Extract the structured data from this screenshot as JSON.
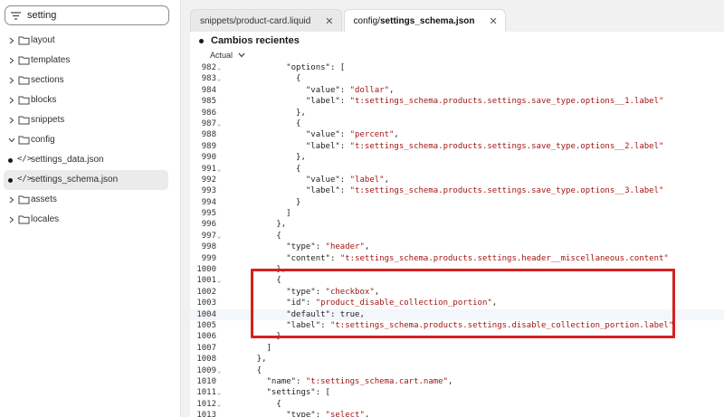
{
  "search": {
    "value": "setting",
    "placeholder": ""
  },
  "tree": [
    {
      "label": "layout",
      "type": "folder"
    },
    {
      "label": "templates",
      "type": "folder"
    },
    {
      "label": "sections",
      "type": "folder"
    },
    {
      "label": "blocks",
      "type": "folder"
    },
    {
      "label": "snippets",
      "type": "folder"
    },
    {
      "label": "config",
      "type": "folder-open"
    },
    {
      "label": "settings_data.json",
      "type": "file"
    },
    {
      "label": "settings_schema.json",
      "type": "file",
      "active": true
    },
    {
      "label": "assets",
      "type": "folder"
    },
    {
      "label": "locales",
      "type": "folder"
    }
  ],
  "tabs": [
    {
      "label": "snippets/product-card.liquid",
      "close": "✕"
    },
    {
      "prefix": "config/",
      "name": "settings_schema.json",
      "close": "✕"
    }
  ],
  "changes": {
    "title": "Cambios recientes",
    "version": "Actual"
  },
  "code": [
    {
      "n": "982",
      "fold": true,
      "t": "          \"options\": ["
    },
    {
      "n": "983",
      "fold": true,
      "t": "            {"
    },
    {
      "n": "984",
      "t": "              \"value\": \"dollar\","
    },
    {
      "n": "985",
      "t": "              \"label\": \"t:settings_schema.products.settings.save_type.options__1.label\""
    },
    {
      "n": "986",
      "t": "            },"
    },
    {
      "n": "987",
      "fold": true,
      "t": "            {"
    },
    {
      "n": "988",
      "t": "              \"value\": \"percent\","
    },
    {
      "n": "989",
      "t": "              \"label\": \"t:settings_schema.products.settings.save_type.options__2.label\""
    },
    {
      "n": "990",
      "t": "            },"
    },
    {
      "n": "991",
      "fold": true,
      "t": "            {"
    },
    {
      "n": "992",
      "t": "              \"value\": \"label\","
    },
    {
      "n": "993",
      "t": "              \"label\": \"t:settings_schema.products.settings.save_type.options__3.label\""
    },
    {
      "n": "994",
      "t": "            }"
    },
    {
      "n": "995",
      "t": "          ]"
    },
    {
      "n": "996",
      "t": "        },"
    },
    {
      "n": "997",
      "fold": true,
      "t": "        {"
    },
    {
      "n": "998",
      "t": "          \"type\": \"header\","
    },
    {
      "n": "999",
      "t": "          \"content\": \"t:settings_schema.products.settings.header__miscellaneous.content\""
    },
    {
      "n": "1000",
      "t": "        },"
    },
    {
      "n": "1001",
      "fold": true,
      "t": "        {"
    },
    {
      "n": "1002",
      "t": "          \"type\": \"checkbox\","
    },
    {
      "n": "1003",
      "t": "          \"id\": \"product_disable_collection_portion\","
    },
    {
      "n": "1004",
      "t": "          \"default\": true,",
      "current": true
    },
    {
      "n": "1005",
      "t": "          \"label\": \"t:settings_schema.products.settings.disable_collection_portion.label\""
    },
    {
      "n": "1006",
      "t": "        }"
    },
    {
      "n": "1007",
      "t": "      ]"
    },
    {
      "n": "1008",
      "t": "    },"
    },
    {
      "n": "1009",
      "fold": true,
      "t": "    {"
    },
    {
      "n": "1010",
      "t": "      \"name\": \"t:settings_schema.cart.name\","
    },
    {
      "n": "1011",
      "fold": true,
      "t": "      \"settings\": ["
    },
    {
      "n": "1012",
      "fold": true,
      "t": "        {"
    },
    {
      "n": "1013",
      "t": "          \"type\": \"select\","
    }
  ],
  "colors": {
    "highlight": "#d62020",
    "string": "#a31515"
  }
}
